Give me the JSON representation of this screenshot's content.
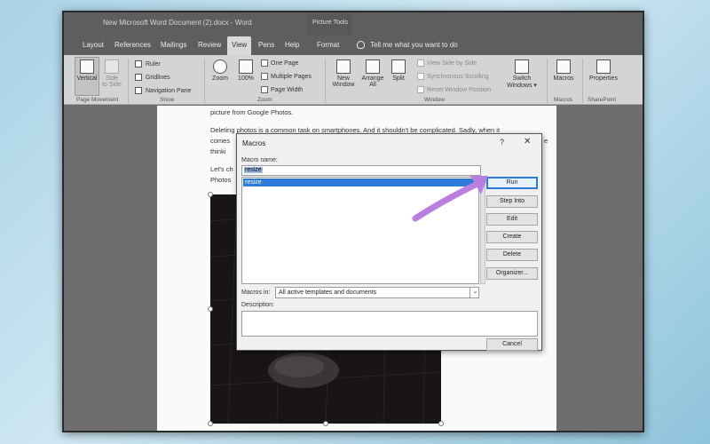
{
  "window": {
    "title": "New Microsoft Word Document (2).docx  -  Word",
    "context_tab_group": "Picture Tools"
  },
  "tabs": {
    "items": [
      {
        "label": "Layout"
      },
      {
        "label": "References"
      },
      {
        "label": "Mailings"
      },
      {
        "label": "Review"
      },
      {
        "label": "View"
      },
      {
        "label": "Pens"
      },
      {
        "label": "Help"
      },
      {
        "label": "Format"
      }
    ],
    "active": "View",
    "tell_me": "Tell me what you want to do"
  },
  "ribbon": {
    "page_movement": {
      "label": "Page Movement",
      "vertical": "Vertical",
      "side_to_side_1": "Side",
      "side_to_side_2": "to Side"
    },
    "show": {
      "label": "Show",
      "ruler": "Ruler",
      "gridlines": "Gridlines",
      "navigation_pane": "Navigation Pane"
    },
    "zoom": {
      "label": "Zoom",
      "zoom": "Zoom",
      "percent": "100%",
      "one_page": "One Page",
      "multiple_pages": "Multiple Pages",
      "page_width": "Page Width"
    },
    "window": {
      "label": "Window",
      "new_window_1": "New",
      "new_window_2": "Window",
      "arrange_all_1": "Arrange",
      "arrange_all_2": "All",
      "split": "Split",
      "view_side_by_side": "View Side by Side",
      "synchronous_scrolling": "Synchronous Scrolling",
      "reset_window_position": "Reset Window Position",
      "switch_windows_1": "Switch",
      "switch_windows_2": "Windows ▾"
    },
    "macros": {
      "label": "Macros",
      "macros_button": "Macros"
    },
    "sharepoint": {
      "label": "SharePoint",
      "properties": "Properties"
    }
  },
  "document": {
    "line1": "picture from Google Photos.",
    "line2": "Deleting photos is a common task on smartphones. And it shouldn't be complicated. Sadly, when it",
    "line3_start": "comes",
    "line3_end": "e",
    "line4": "thinki",
    "line5": "Let's ch",
    "line6": "Photos"
  },
  "dialog": {
    "title": "Macros",
    "help": "?",
    "close": "✕",
    "macro_name_label": "Macro name:",
    "macro_name_value": "resize",
    "list_items": [
      "resize"
    ],
    "macros_in_label": "Macros in:",
    "macros_in_value": "All active templates and documents",
    "description_label": "Description:",
    "buttons": {
      "run": "Run",
      "step_into": "Step Into",
      "edit": "Edit",
      "create": "Create",
      "delete": "Delete",
      "organizer": "Organizer...",
      "cancel": "Cancel"
    }
  },
  "colors": {
    "arrow": "#b97ee0",
    "selection": "#2d7bd6"
  }
}
